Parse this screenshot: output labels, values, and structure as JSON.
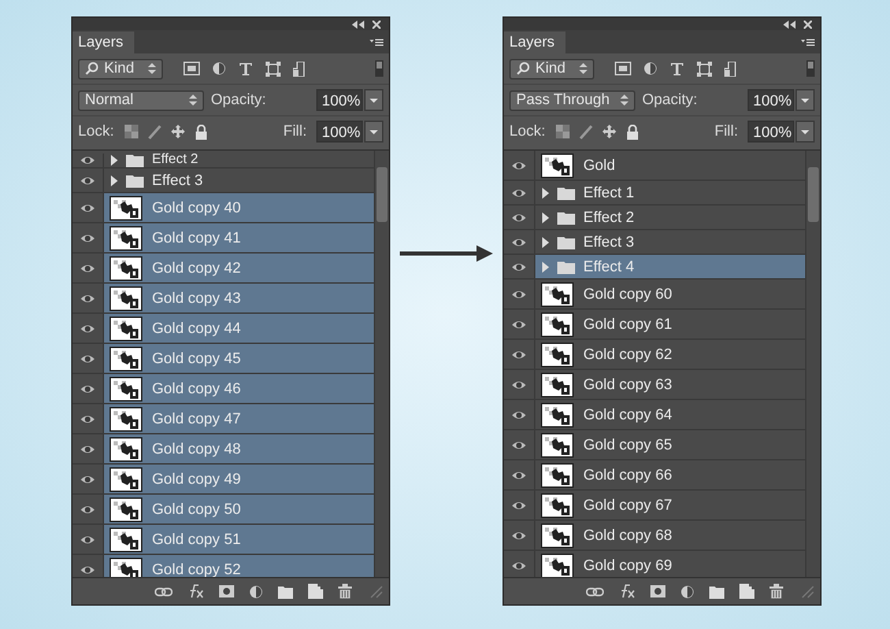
{
  "panels": [
    {
      "tab": "Layers",
      "filter": "Kind",
      "blend_mode": "Normal",
      "opacity_label": "Opacity:",
      "opacity": "100%",
      "lock_label": "Lock:",
      "fill_label": "Fill:",
      "fill": "100%",
      "layers": [
        {
          "kind": "group",
          "name": "Effect 2",
          "visible": true,
          "selected": false,
          "partial": true
        },
        {
          "kind": "group",
          "name": "Effect 3",
          "visible": true,
          "selected": false
        },
        {
          "kind": "layer",
          "name": "Gold copy 40",
          "visible": true,
          "selected": true
        },
        {
          "kind": "layer",
          "name": "Gold copy 41",
          "visible": true,
          "selected": true
        },
        {
          "kind": "layer",
          "name": "Gold copy 42",
          "visible": true,
          "selected": true
        },
        {
          "kind": "layer",
          "name": "Gold copy 43",
          "visible": true,
          "selected": true
        },
        {
          "kind": "layer",
          "name": "Gold copy 44",
          "visible": true,
          "selected": true
        },
        {
          "kind": "layer",
          "name": "Gold copy 45",
          "visible": true,
          "selected": true
        },
        {
          "kind": "layer",
          "name": "Gold copy 46",
          "visible": true,
          "selected": true
        },
        {
          "kind": "layer",
          "name": "Gold copy 47",
          "visible": true,
          "selected": true
        },
        {
          "kind": "layer",
          "name": "Gold copy 48",
          "visible": true,
          "selected": true
        },
        {
          "kind": "layer",
          "name": "Gold copy 49",
          "visible": true,
          "selected": true
        },
        {
          "kind": "layer",
          "name": "Gold copy 50",
          "visible": true,
          "selected": true
        },
        {
          "kind": "layer",
          "name": "Gold copy 51",
          "visible": true,
          "selected": true
        },
        {
          "kind": "layer",
          "name": "Gold copy 52",
          "visible": true,
          "selected": true
        }
      ]
    },
    {
      "tab": "Layers",
      "filter": "Kind",
      "blend_mode": "Pass Through",
      "opacity_label": "Opacity:",
      "opacity": "100%",
      "lock_label": "Lock:",
      "fill_label": "Fill:",
      "fill": "100%",
      "layers": [
        {
          "kind": "layer",
          "name": "Gold",
          "visible": true,
          "selected": false
        },
        {
          "kind": "group",
          "name": "Effect 1",
          "visible": true,
          "selected": false
        },
        {
          "kind": "group",
          "name": "Effect 2",
          "visible": true,
          "selected": false
        },
        {
          "kind": "group",
          "name": "Effect 3",
          "visible": true,
          "selected": false
        },
        {
          "kind": "group",
          "name": "Effect 4",
          "visible": true,
          "selected": true
        },
        {
          "kind": "layer",
          "name": "Gold copy 60",
          "visible": true,
          "selected": false
        },
        {
          "kind": "layer",
          "name": "Gold copy 61",
          "visible": true,
          "selected": false
        },
        {
          "kind": "layer",
          "name": "Gold copy 62",
          "visible": true,
          "selected": false
        },
        {
          "kind": "layer",
          "name": "Gold copy 63",
          "visible": true,
          "selected": false
        },
        {
          "kind": "layer",
          "name": "Gold copy 64",
          "visible": true,
          "selected": false
        },
        {
          "kind": "layer",
          "name": "Gold copy 65",
          "visible": true,
          "selected": false
        },
        {
          "kind": "layer",
          "name": "Gold copy 66",
          "visible": true,
          "selected": false
        },
        {
          "kind": "layer",
          "name": "Gold copy 67",
          "visible": true,
          "selected": false
        },
        {
          "kind": "layer",
          "name": "Gold copy 68",
          "visible": true,
          "selected": false
        },
        {
          "kind": "layer",
          "name": "Gold copy 69",
          "visible": true,
          "selected": false
        }
      ]
    }
  ]
}
